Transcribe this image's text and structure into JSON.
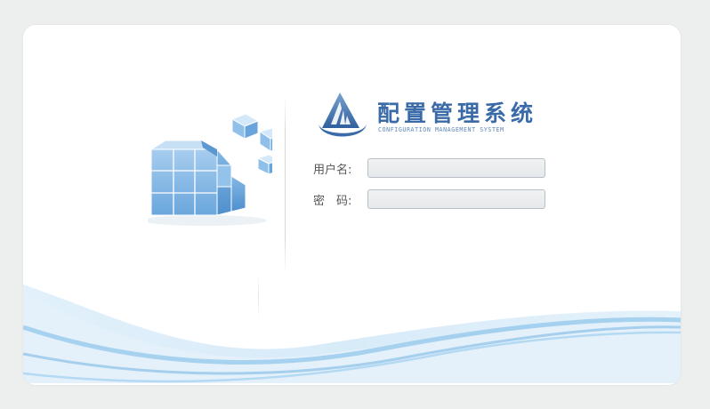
{
  "app": {
    "title_cn": "配置管理系统",
    "title_en": "CONFIGURATION MANAGEMENT SYSTEM"
  },
  "login": {
    "username_label": "用户名:",
    "username_value": "",
    "password_label": "密　码:",
    "password_value": ""
  },
  "icons": {
    "logo": "triangle-logo-icon",
    "illustration": "cubes-icon"
  },
  "colors": {
    "brand_blue": "#3a6aa8",
    "wave_blue": "#9ccbed"
  }
}
